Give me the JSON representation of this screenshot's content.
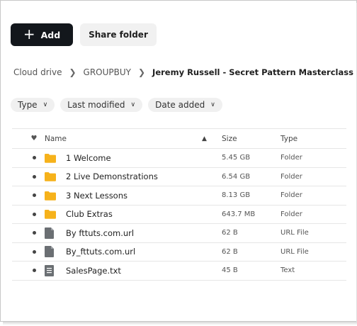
{
  "toolbar": {
    "add_label": "Add",
    "share_label": "Share folder"
  },
  "breadcrumb": {
    "items": [
      "Cloud drive",
      "GROUPBUY",
      "Jeremy Russell - Secret Pattern Masterclass"
    ]
  },
  "filters": [
    "Type",
    "Last modified",
    "Date added"
  ],
  "table": {
    "columns": {
      "name": "Name",
      "size": "Size",
      "type": "Type"
    },
    "rows": [
      {
        "name": "1 Welcome",
        "size": "5.45 GB",
        "type": "Folder",
        "icon": "folder-icon"
      },
      {
        "name": "2 Live Demonstrations",
        "size": "6.54 GB",
        "type": "Folder",
        "icon": "folder-icon"
      },
      {
        "name": "3 Next Lessons",
        "size": "8.13 GB",
        "type": "Folder",
        "icon": "folder-icon"
      },
      {
        "name": "Club Extras",
        "size": "643.7 MB",
        "type": "Folder",
        "icon": "folder-icon"
      },
      {
        "name": "By fttuts.com.url",
        "size": "62 B",
        "type": "URL File",
        "icon": "url-file-icon"
      },
      {
        "name": "By_fttuts.com.url",
        "size": "62 B",
        "type": "URL File",
        "icon": "url-file-icon"
      },
      {
        "name": "SalesPage.txt",
        "size": "45 B",
        "type": "Text",
        "icon": "text-file-icon"
      }
    ]
  },
  "colors": {
    "add_button": "#13171c",
    "share_button": "#f1f1f1",
    "folder": "#f6b21b",
    "file": "#6b6f73"
  }
}
